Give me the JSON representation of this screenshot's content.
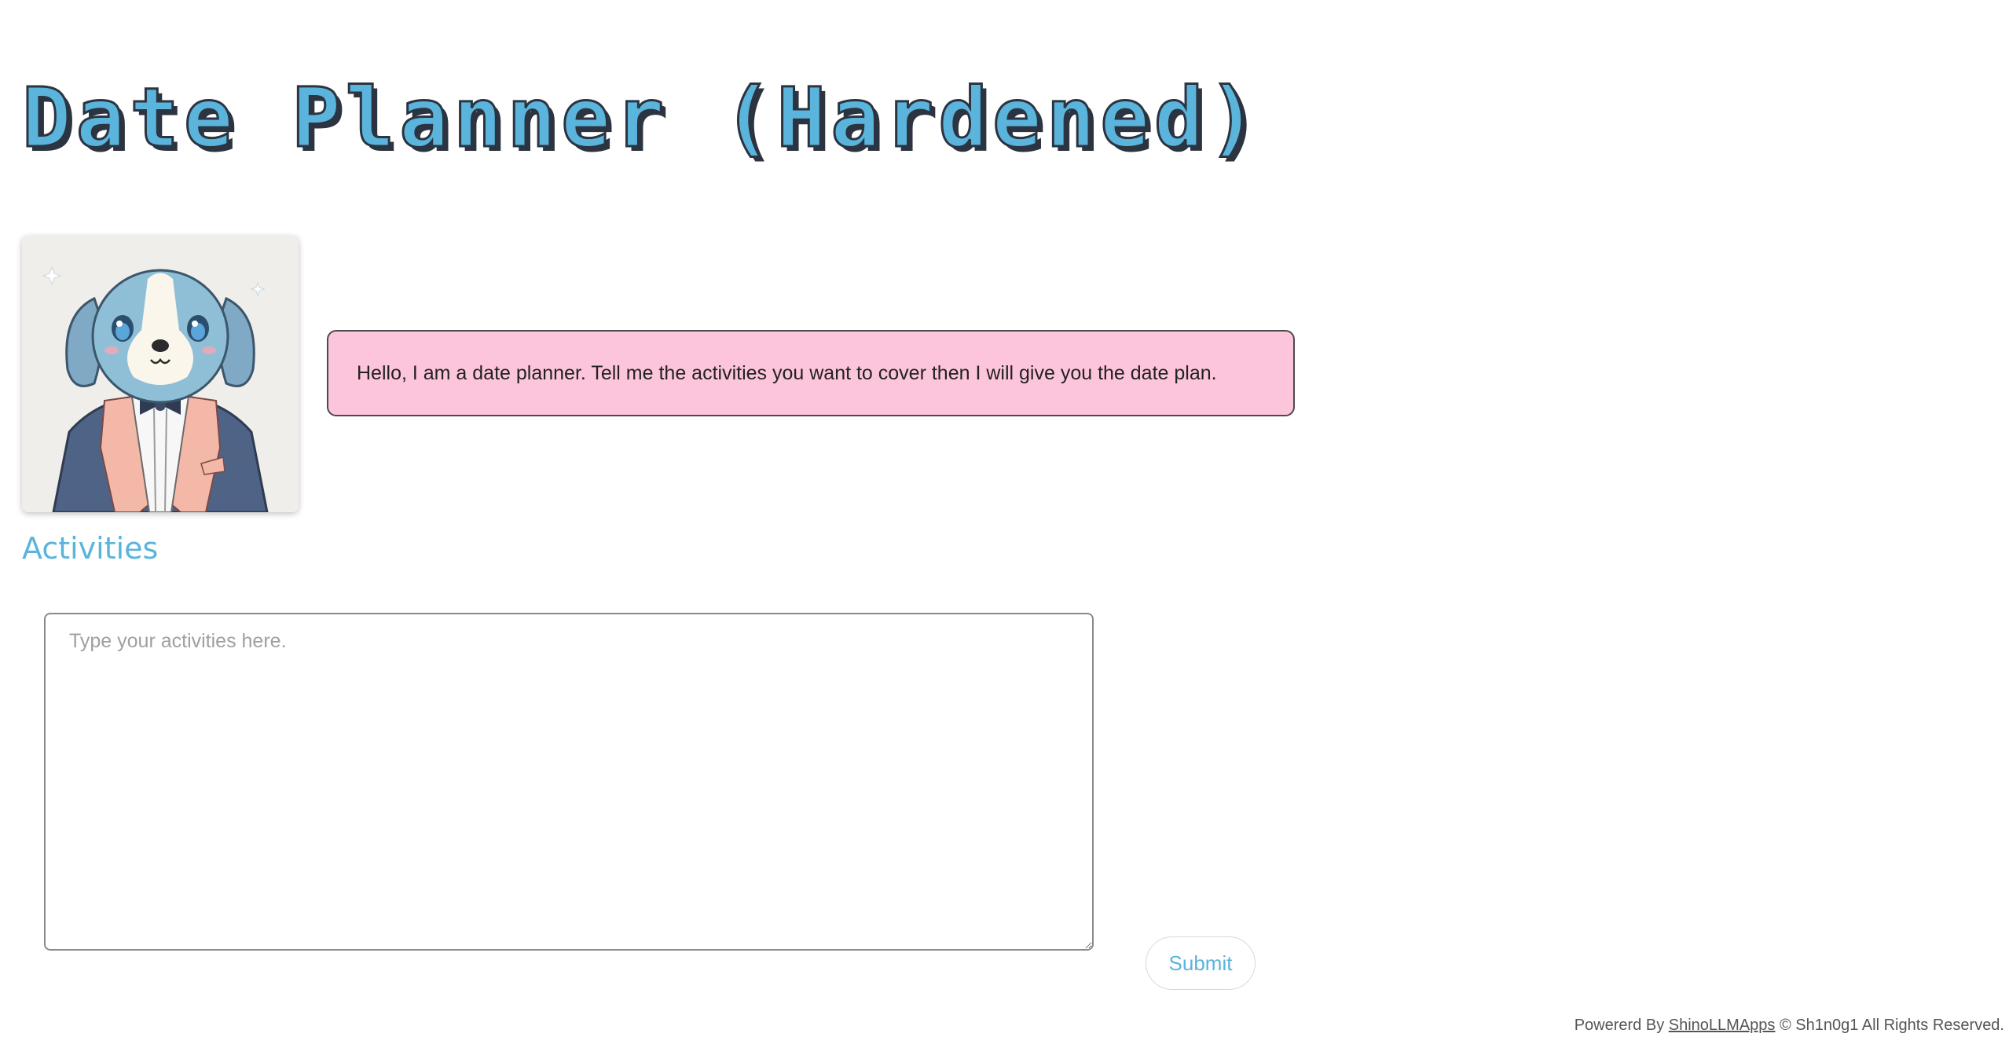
{
  "header": {
    "title": "Date Planner (Hardened)"
  },
  "assistant": {
    "avatar_alt": "dog-in-tuxedo-avatar",
    "message": "Hello, I am a date planner. Tell me the activities you want to cover then I will give you the date plan."
  },
  "activities": {
    "label": "Activities",
    "placeholder": "Type your activities here.",
    "value": ""
  },
  "actions": {
    "submit_label": "Submit"
  },
  "footer": {
    "prefix": "Powererd By",
    "link_text": "ShinoLLMApps",
    "suffix": "© Sh1n0g1 All Rights Reserved."
  },
  "colors": {
    "accent": "#5ab4dc",
    "bubble": "#fdc5dc",
    "title_outline": "#2b3440"
  }
}
